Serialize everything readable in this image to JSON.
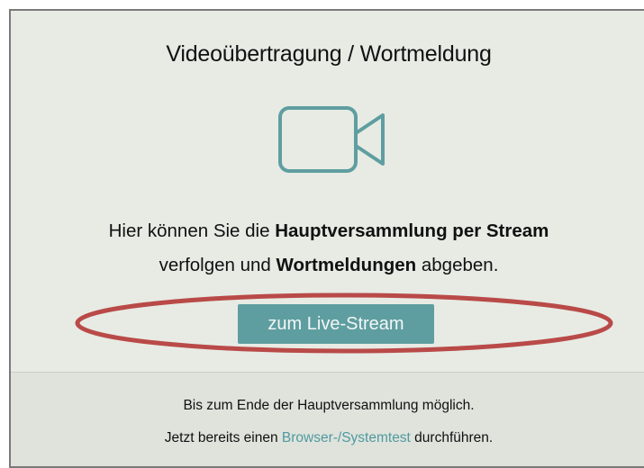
{
  "panel": {
    "title": "Videoübertragung / Wortmeldung",
    "camera_icon": "video-camera-icon",
    "intro": {
      "part1": "Hier können Sie die ",
      "bold1": "Hauptversammlung per Stream",
      "part2": "verfolgen und ",
      "bold2": "Wortmeldungen",
      "part3": " abgeben."
    },
    "cta_label": "zum Live-Stream"
  },
  "footer": {
    "line1": "Bis zum Ende der Hauptversammlung möglich.",
    "line2_prefix": "Jetzt bereits einen ",
    "line2_link": "Browser-/Systemtest",
    "line2_suffix": " durchführen."
  },
  "colors": {
    "accent": "#5f9ea0",
    "link": "#4f9aa0",
    "background": "#e7ebe4",
    "footer_background": "#dfe3dc",
    "highlight": "#b94a48"
  }
}
